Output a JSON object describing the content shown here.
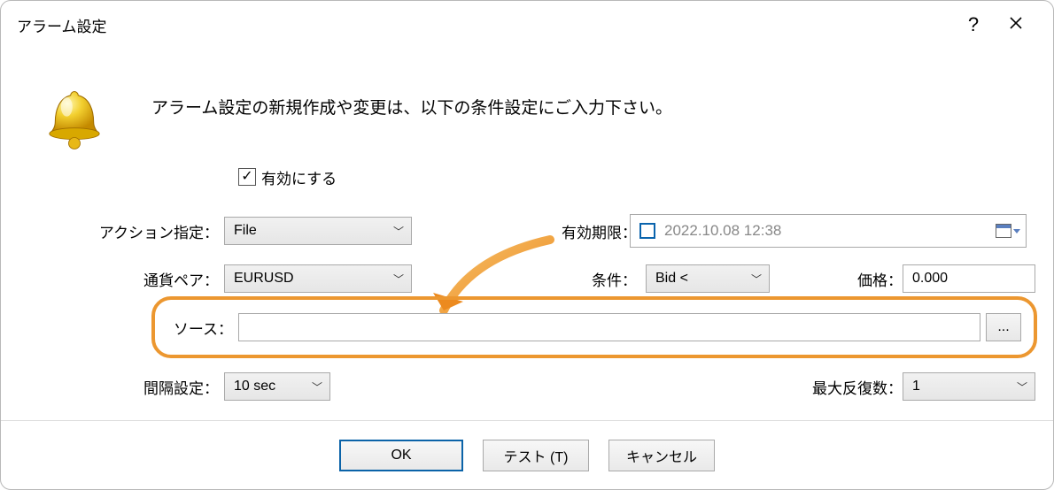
{
  "window": {
    "title": "アラーム設定"
  },
  "instruction": "アラーム設定の新規作成や変更は、以下の条件設定にご入力下さい。",
  "enable": {
    "label": "有効にする",
    "checked": true
  },
  "action": {
    "label": "アクション指定：",
    "value": "File"
  },
  "symbol": {
    "label": "通貨ペア：",
    "value": "EURUSD"
  },
  "expiration": {
    "label": "有効期限：",
    "value": "2022.10.08 12:38",
    "checked": false
  },
  "condition": {
    "label": "条件：",
    "value": "Bid <"
  },
  "price": {
    "label": "価格：",
    "value": "0.000"
  },
  "source": {
    "label": "ソース：",
    "value": "",
    "browse": "..."
  },
  "interval": {
    "label": "間隔設定：",
    "value": "10 sec"
  },
  "maxrev": {
    "label": "最大反復数：",
    "value": "1"
  },
  "buttons": {
    "ok": "OK",
    "test": "テスト (T)",
    "cancel": "キャンセル"
  }
}
